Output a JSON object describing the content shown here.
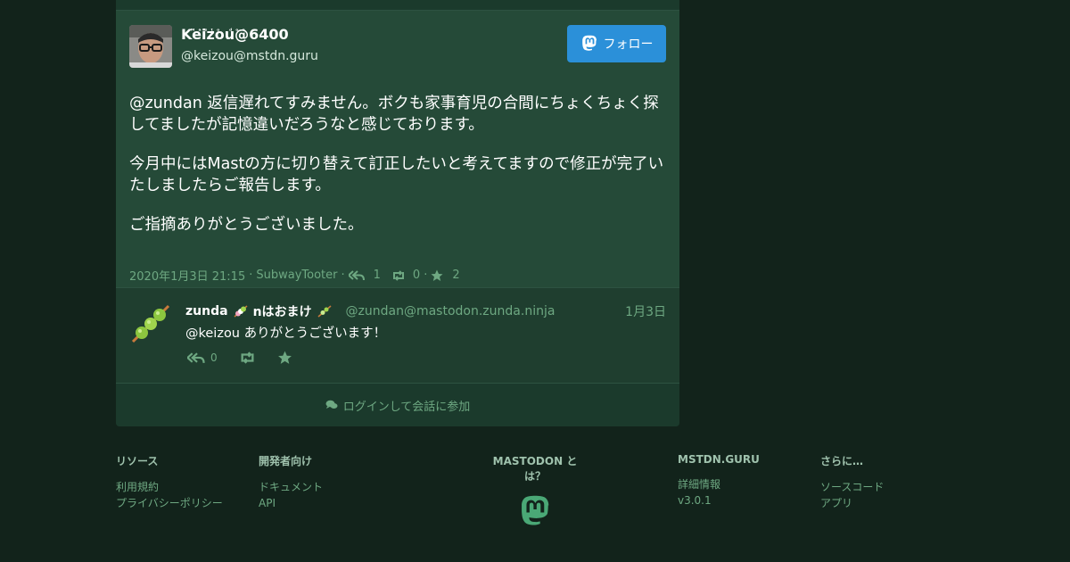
{
  "status": {
    "display_name": "Keizou@6400",
    "display_name_emoji": "ᴹᵃˢᵗᵒ ᵈᵒⁿ",
    "acct": "@keizou@mstdn.guru",
    "follow_label": "フォロー",
    "paragraphs": [
      "@zundan 返信遅れてすみません。ボクも家事育児の合間にちょくちょく探してましたが記憶違いだろうなと感じております。",
      "今月中にはMastの方に切り替えて訂正したいと考えてますので修正が完了いたしましたらご報告します。",
      "ご指摘ありがとうございました。"
    ],
    "meta": {
      "datetime": "2020年1月3日 21:15",
      "separator": "·",
      "application": "SubwayTooter",
      "replies": "1",
      "reblogs": "0",
      "favourites": "2"
    }
  },
  "reply": {
    "display_name_prefix": "zunda",
    "display_name_middle": "nはおまけ",
    "acct": "@zundan@mastodon.zunda.ninja",
    "date": "1月3日",
    "text": "@keizou ありがとうございます！",
    "replies": "0"
  },
  "login_prompt": "ログインして会話に参加",
  "footer": {
    "resources": {
      "title": "リソース",
      "links": [
        "利用規約",
        "プライバシーポリシー"
      ]
    },
    "developers": {
      "title": "開発者向け",
      "links": [
        "ドキュメント",
        "API"
      ]
    },
    "about": {
      "title": "MASTODON とは？"
    },
    "server": {
      "title": "MSTDN.GURU",
      "links": [
        "詳細情報",
        "v3.0.1"
      ]
    },
    "more": {
      "title": "さらに…",
      "links": [
        "ソースコード",
        "アプリ"
      ]
    }
  },
  "colors": {
    "accent": "#2b90d9",
    "muted": "#6ea882",
    "background": "#12231b"
  }
}
